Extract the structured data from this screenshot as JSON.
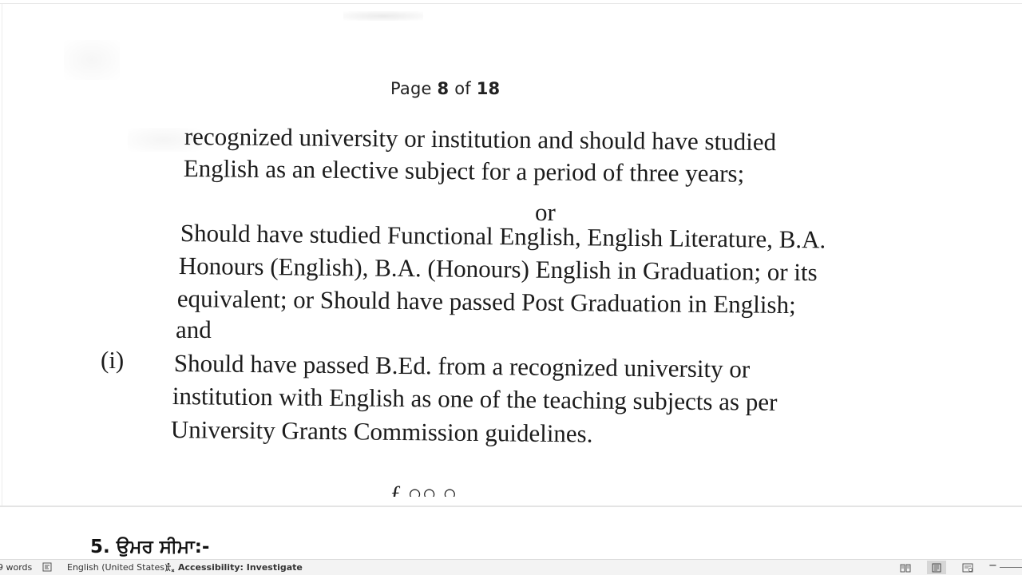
{
  "document": {
    "page_header_prefix": "Page ",
    "page_current": "8",
    "page_header_mid": " of ",
    "page_total": "18",
    "lines": [
      "recognized university or institution and should have studied",
      "English as an elective subject for a period of three years;",
      "or",
      "Should have studied Functional English, English Literature, B.A.",
      "Honours (English), B.A. (Honours) English in Graduation; or its",
      "equivalent; or  Should have passed Post Graduation in English;",
      "and",
      "Should have passed B.Ed. from a recognized university or",
      "institution with English as one of the teaching subjects as per",
      "University Grants Commission guidelines."
    ],
    "item_marker": "(i)",
    "next_page_heading": "5. ਉਮਰ ਸੀਮਾ:-"
  },
  "status_bar": {
    "word_count": "9 words",
    "language": "English (United States)",
    "accessibility": "Accessibility: Investigate"
  }
}
